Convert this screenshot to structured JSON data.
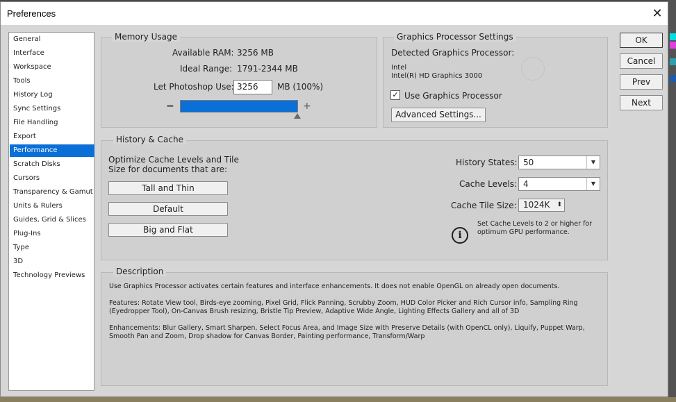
{
  "window": {
    "title": "Preferences"
  },
  "buttons": {
    "ok": "OK",
    "cancel": "Cancel",
    "prev": "Prev",
    "next": "Next"
  },
  "sidebar": {
    "items": [
      {
        "label": "General"
      },
      {
        "label": "Interface"
      },
      {
        "label": "Workspace"
      },
      {
        "label": "Tools"
      },
      {
        "label": "History Log"
      },
      {
        "label": "Sync Settings"
      },
      {
        "label": "File Handling"
      },
      {
        "label": "Export"
      },
      {
        "label": "Performance",
        "selected": true
      },
      {
        "label": "Scratch Disks"
      },
      {
        "label": "Cursors"
      },
      {
        "label": "Transparency & Gamut"
      },
      {
        "label": "Units & Rulers"
      },
      {
        "label": "Guides, Grid & Slices"
      },
      {
        "label": "Plug-Ins"
      },
      {
        "label": "Type"
      },
      {
        "label": "3D"
      },
      {
        "label": "Technology Previews"
      }
    ]
  },
  "memory": {
    "title": "Memory Usage",
    "available_label": "Available RAM:",
    "available_value": "3256 MB",
    "ideal_label": "Ideal Range:",
    "ideal_value": "1791-2344 MB",
    "let_label": "Let Photoshop Use:",
    "let_value": "3256",
    "let_suffix": "MB (100%)",
    "minus": "−",
    "plus": "+",
    "slider_percent": 100
  },
  "gpu": {
    "title": "Graphics Processor Settings",
    "detected_label": "Detected Graphics Processor:",
    "vendor": "Intel",
    "model": "Intel(R) HD Graphics 3000",
    "use_label": "Use Graphics Processor",
    "use_checked": true,
    "advanced_button": "Advanced Settings..."
  },
  "history": {
    "title": "History & Cache",
    "optimize_line1": "Optimize Cache Levels and Tile",
    "optimize_line2": "Size for documents that are:",
    "btn_tall": "Tall and Thin",
    "btn_default": "Default",
    "btn_big": "Big and Flat",
    "states_label": "History States:",
    "states_value": "50",
    "levels_label": "Cache Levels:",
    "levels_value": "4",
    "tile_label": "Cache Tile Size:",
    "tile_value": "1024K",
    "hint_line1": "Set Cache Levels to 2 or higher for",
    "hint_line2": "optimum GPU performance."
  },
  "description": {
    "title": "Description",
    "p1": "Use Graphics Processor activates certain features and interface enhancements. It does not enable OpenGL on already open documents.",
    "p2": "Features: Rotate View tool, Birds-eye zooming, Pixel Grid, Flick Panning, Scrubby Zoom, HUD Color Picker and Rich Cursor info, Sampling Ring (Eyedropper Tool), On-Canvas Brush resizing, Bristle Tip Preview, Adaptive Wide Angle, Lighting Effects Gallery and all of 3D",
    "p3": "Enhancements: Blur Gallery, Smart Sharpen, Select Focus Area, and Image Size with Preserve Details (with OpenCL only), Liquify, Puppet Warp, Smooth Pan and Zoom, Drop shadow for Canvas Border, Painting performance, Transform/Warp"
  },
  "colors": {
    "accent": "#0a6fd6",
    "slider_fill": "#0a6fd6"
  }
}
